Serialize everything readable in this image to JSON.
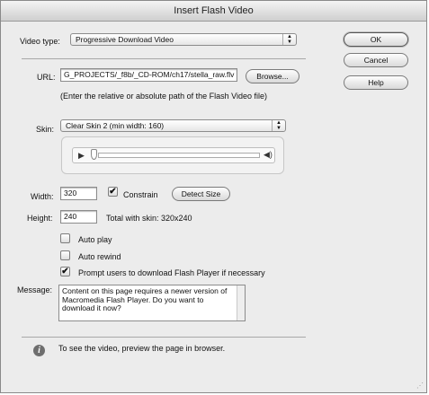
{
  "window": {
    "title": "Insert Flash Video"
  },
  "video_type": {
    "label": "Video type:",
    "value": "Progressive Download Video"
  },
  "url": {
    "label": "URL:",
    "value": "G_PROJECTS/_f8b/_CD-ROM/ch17/stella_raw.flv",
    "browse_label": "Browse...",
    "hint": "(Enter the relative or absolute path of the Flash Video file)"
  },
  "skin": {
    "label": "Skin:",
    "value": "Clear Skin 2 (min width: 160)"
  },
  "width": {
    "label": "Width:",
    "value": "320",
    "constrain_label": "Constrain",
    "constrain_checked": true,
    "detect_label": "Detect Size"
  },
  "height": {
    "label": "Height:",
    "value": "240",
    "total_text": "Total with skin: 320x240"
  },
  "options": {
    "auto_play": {
      "label": "Auto play",
      "checked": false
    },
    "auto_rewind": {
      "label": "Auto rewind",
      "checked": false
    },
    "prompt_download": {
      "label": "Prompt users to download Flash Player if necessary",
      "checked": true
    }
  },
  "message": {
    "label": "Message:",
    "text": "Content on this page requires a newer version of Macromedia Flash Player. Do you want to download it now?"
  },
  "footer": {
    "info_text": "To see the video, preview the page in browser."
  },
  "buttons": {
    "ok": "OK",
    "cancel": "Cancel",
    "help": "Help"
  },
  "colors": {
    "window_bg": "#ececec",
    "default_button_border": "#555555"
  }
}
